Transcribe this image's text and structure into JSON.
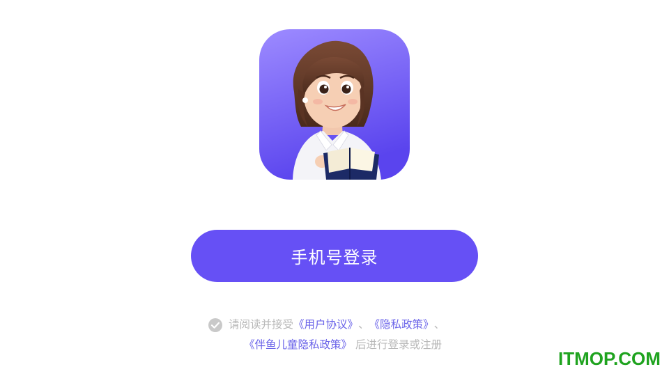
{
  "app": {
    "logo_icon": "teacher-reading-book-avatar",
    "logo_bg_colors": [
      "#9b86ff",
      "#5b46ee"
    ]
  },
  "login": {
    "phone_login_label": "手机号登录",
    "button_color": "#6650f5"
  },
  "agreement": {
    "checkbox_icon": "check-circle-icon",
    "checked": true,
    "prefix": "请阅读并接受",
    "user_agreement": "《用户协议》",
    "separator1": "、",
    "privacy_policy": "《隐私政策》",
    "separator2": "、",
    "child_privacy_policy": "《伴鱼儿童隐私政策》",
    "suffix": "后进行登录或注册",
    "link_color": "#6a63e9",
    "text_color": "#b8b8b8"
  },
  "watermark": {
    "text": "ITMOP.COM",
    "color": "#1fa31f"
  }
}
